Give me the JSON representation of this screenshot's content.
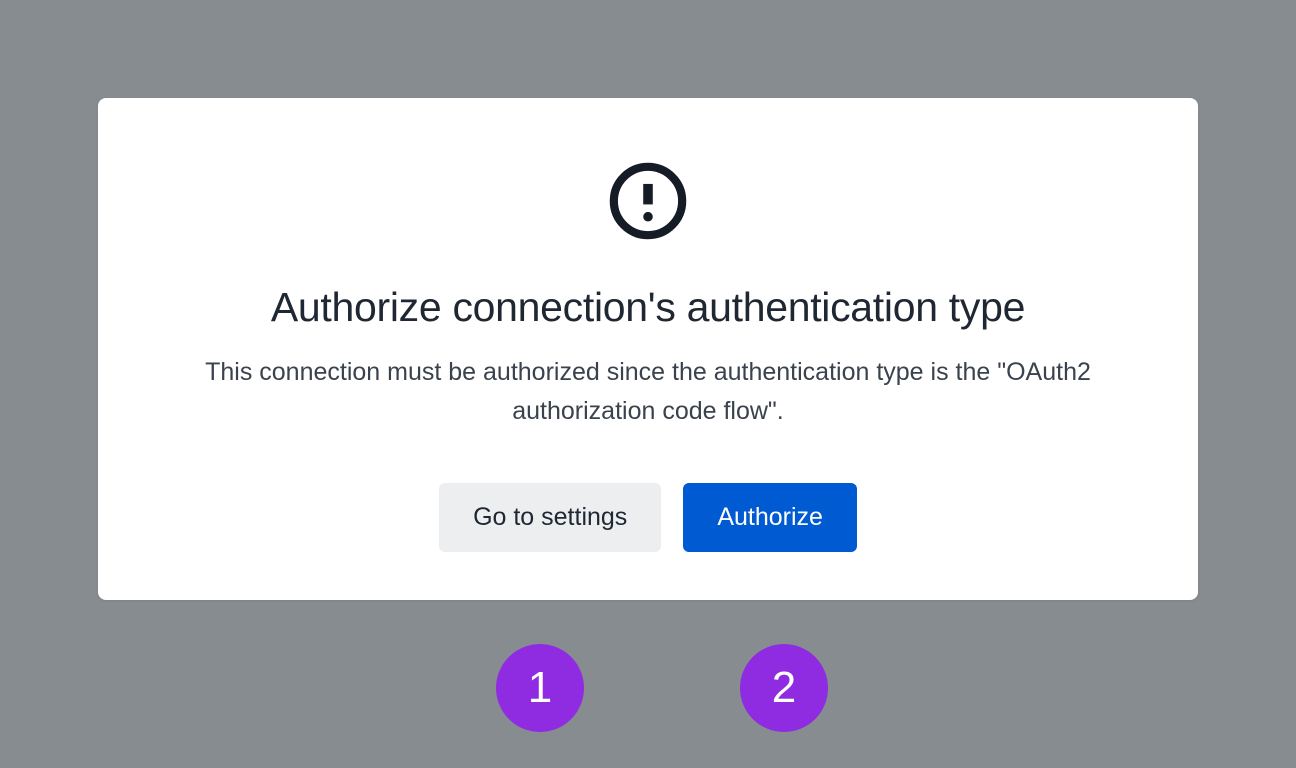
{
  "dialog": {
    "title": "Authorize connection's authentication type",
    "description": "This connection must be authorized since the authentication type is the \"OAuth2 authorization code flow\".",
    "buttons": {
      "settings": "Go to settings",
      "authorize": "Authorize"
    }
  },
  "callouts": {
    "one": "1",
    "two": "2"
  }
}
